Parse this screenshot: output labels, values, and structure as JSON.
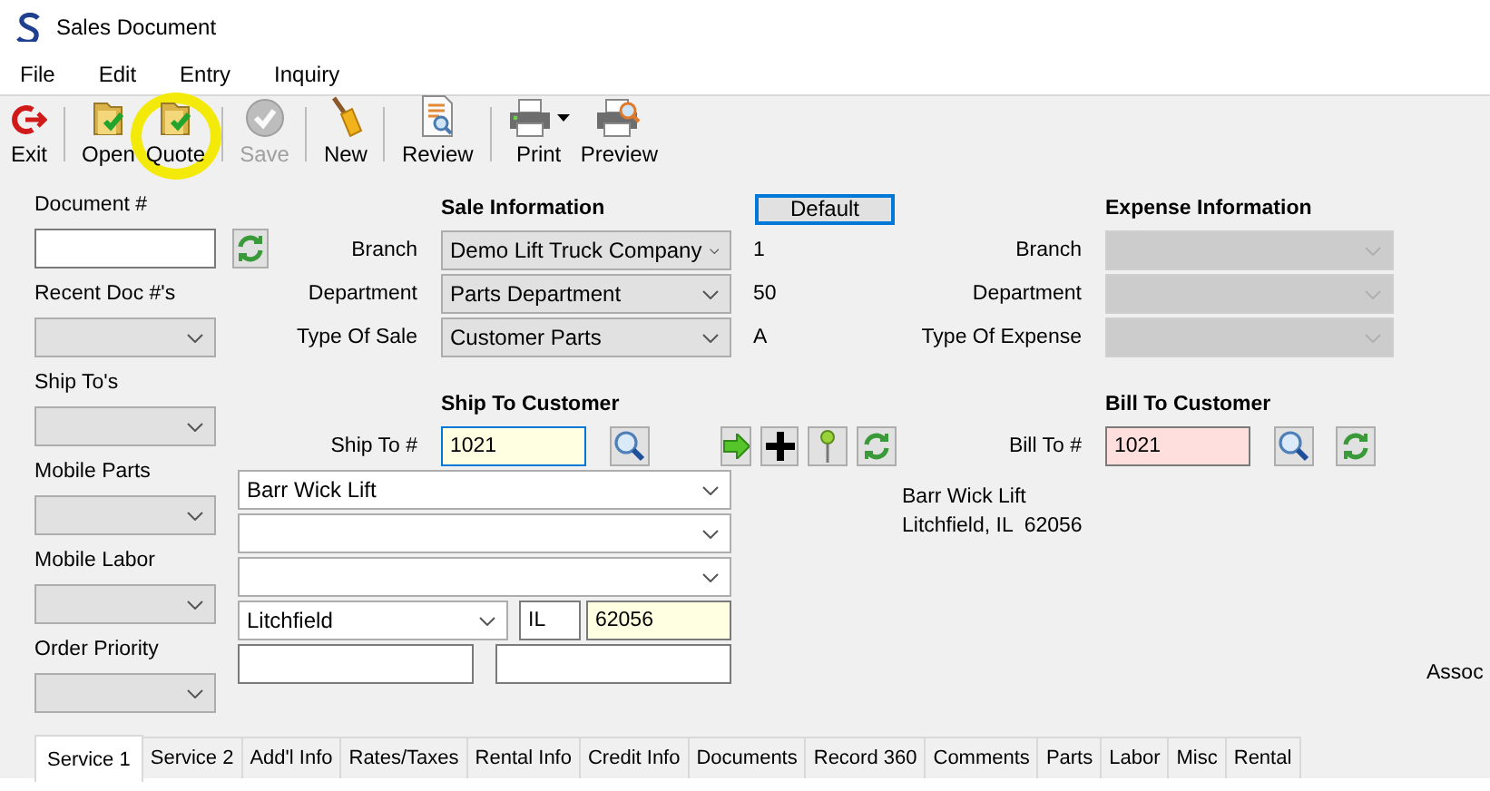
{
  "window": {
    "title": "Sales Document"
  },
  "menu": [
    {
      "label": "File"
    },
    {
      "label": "Edit"
    },
    {
      "label": "Entry"
    },
    {
      "label": "Inquiry"
    }
  ],
  "toolbar": [
    {
      "label": "Exit",
      "disabled": false,
      "highlighted": false
    },
    {
      "label": "Open",
      "disabled": false,
      "highlighted": false
    },
    {
      "label": "Quote",
      "disabled": false,
      "highlighted": true
    },
    {
      "label": "Save",
      "disabled": true,
      "highlighted": false
    },
    {
      "label": "New",
      "disabled": false,
      "highlighted": false
    },
    {
      "label": "Review",
      "disabled": false,
      "highlighted": false
    },
    {
      "label": "Print",
      "disabled": false,
      "highlighted": false
    },
    {
      "label": "Preview",
      "disabled": false,
      "highlighted": false
    }
  ],
  "left_panel": [
    {
      "label": "Document #",
      "kind": "text"
    },
    {
      "label": "Recent Doc #'s",
      "kind": "combo"
    },
    {
      "label": "Ship To's",
      "kind": "combo"
    },
    {
      "label": "Mobile Parts",
      "kind": "combo"
    },
    {
      "label": "Mobile Labor",
      "kind": "combo"
    },
    {
      "label": "Order Priority",
      "kind": "combo"
    }
  ],
  "sale_information": {
    "heading": "Sale Information",
    "default_button": "Default",
    "rows": [
      {
        "label": "Branch",
        "value": "Demo Lift Truck Company",
        "code": "1"
      },
      {
        "label": "Department",
        "value": "Parts Department",
        "code": "50"
      },
      {
        "label": "Type Of Sale",
        "value": "Customer Parts",
        "code": "A"
      }
    ]
  },
  "expense_information": {
    "heading": "Expense Information",
    "rows": [
      {
        "label": "Branch",
        "disabled": true
      },
      {
        "label": "Department",
        "disabled": true
      },
      {
        "label": "Type Of Expense",
        "disabled": true
      }
    ]
  },
  "ship_to": {
    "heading": "Ship To Customer",
    "label": "Ship To #",
    "value": "1021",
    "required": true,
    "focused": true,
    "address_lines": [
      "Barr Wick Lift"
    ],
    "city": "Litchfield",
    "state": "IL",
    "zip": "62056",
    "zip_required": true
  },
  "summary": [
    "Barr Wick Lift",
    "Litchfield, IL  62056"
  ],
  "bill_to": {
    "heading": "Bill To Customer",
    "label": "Bill To #",
    "value": "1021",
    "invalid": true
  },
  "side_label": "Assoc",
  "tabs": [
    {
      "label": "Service 1",
      "selected": true
    },
    {
      "label": "Service 2",
      "selected": false
    },
    {
      "label": "Add'l Info",
      "selected": false
    },
    {
      "label": "Rates/Taxes",
      "selected": false
    },
    {
      "label": "Rental Info",
      "selected": false
    },
    {
      "label": "Credit Info",
      "selected": false
    },
    {
      "label": "Documents",
      "selected": false
    },
    {
      "label": "Record 360",
      "selected": false
    },
    {
      "label": "Comments",
      "selected": false
    },
    {
      "label": "Parts",
      "selected": false
    },
    {
      "label": "Labor",
      "selected": false
    },
    {
      "label": "Misc",
      "selected": false
    },
    {
      "label": "Rental",
      "selected": false
    }
  ]
}
